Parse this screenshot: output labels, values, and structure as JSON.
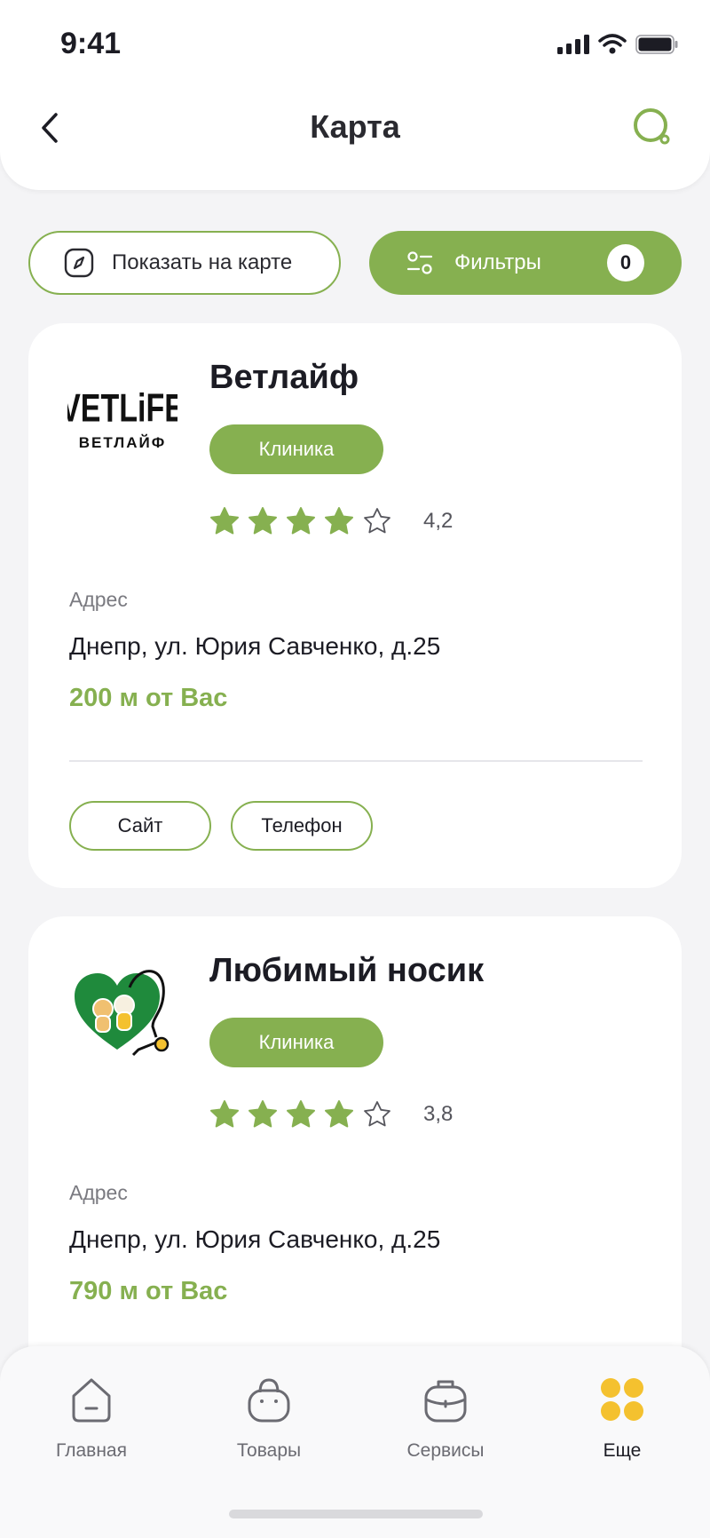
{
  "status_bar": {
    "time": "9:41"
  },
  "header": {
    "title": "Карта"
  },
  "actions": {
    "show_on_map_label": "Показать на карте",
    "filters_label": "Фильтры",
    "filters_count": "0"
  },
  "clinics": [
    {
      "name": "Ветлайф",
      "logo_text_top": "VETLiFE",
      "logo_text_bottom": "ВЕТЛАЙФ",
      "tag": "Клиника",
      "rating": "4,2",
      "stars_filled": 4,
      "address_label": "Адрес",
      "address": "Днепр, ул. Юрия Савченко, д.25",
      "distance": "200 м от Вас",
      "site_label": "Сайт",
      "phone_label": "Телефон"
    },
    {
      "name": "Любимый носик",
      "tag": "Клиника",
      "rating": "3,8",
      "stars_filled": 4,
      "address_label": "Адрес",
      "address": "Днепр, ул. Юрия Савченко, д.25",
      "distance": "790 м от Вас"
    }
  ],
  "bottom_nav": {
    "items": [
      {
        "label": "Главная",
        "icon": "home-icon"
      },
      {
        "label": "Товары",
        "icon": "bag-icon"
      },
      {
        "label": "Сервисы",
        "icon": "briefcase-icon"
      },
      {
        "label": "Еще",
        "icon": "more-grid-icon"
      }
    ]
  },
  "colors": {
    "accent": "#86b050",
    "nav_active": "#f4c12f",
    "background": "#f4f4f6"
  }
}
